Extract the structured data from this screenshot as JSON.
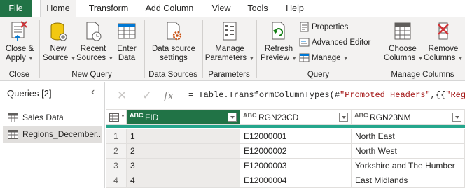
{
  "tabs": [
    "File",
    "Home",
    "Transform",
    "Add Column",
    "View",
    "Tools",
    "Help"
  ],
  "ribbon": {
    "close": {
      "label1": "Close &",
      "label2": "Apply",
      "group": "Close"
    },
    "new_query": {
      "new_source": [
        "New",
        "Source"
      ],
      "recent_sources": [
        "Recent",
        "Sources"
      ],
      "enter_data": [
        "Enter",
        "Data"
      ],
      "group": "New Query"
    },
    "data_sources": {
      "label1": "Data source",
      "label2": "settings",
      "group": "Data Sources"
    },
    "parameters": {
      "label1": "Manage",
      "label2": "Parameters",
      "group": "Parameters"
    },
    "query": {
      "refresh": [
        "Refresh",
        "Preview"
      ],
      "properties": "Properties",
      "advanced_editor": "Advanced Editor",
      "manage": "Manage",
      "group": "Query"
    },
    "manage_columns": {
      "choose": [
        "Choose",
        "Columns"
      ],
      "remove": [
        "Remove",
        "Columns"
      ],
      "group": "Manage Columns"
    }
  },
  "queries": {
    "title": "Queries [2]",
    "items": [
      "Sales Data",
      "Regions_December..."
    ]
  },
  "formula": {
    "prefix": "= Table.TransformColumnTypes(#",
    "string": "\"Promoted Headers\"",
    "suffix": ",{{",
    "string2": "\"RegionI"
  },
  "grid": {
    "type_badge": "ABC",
    "columns": [
      "FID",
      "RGN23CD",
      "RGN23NM"
    ],
    "rows": [
      {
        "n": "1",
        "fid": "1",
        "cd": "E12000001",
        "nm": "North East"
      },
      {
        "n": "2",
        "fid": "2",
        "cd": "E12000002",
        "nm": "North West"
      },
      {
        "n": "3",
        "fid": "3",
        "cd": "E12000003",
        "nm": "Yorkshire and The Humber"
      },
      {
        "n": "4",
        "fid": "4",
        "cd": "E12000004",
        "nm": "East Midlands"
      }
    ]
  },
  "colors": {
    "accent": "#217346",
    "quality_bar": "#25a68c",
    "ribbon_bg": "#f3f2f1"
  }
}
